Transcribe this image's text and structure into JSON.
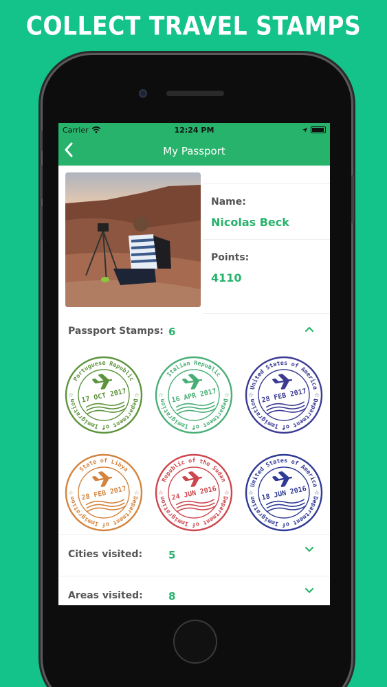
{
  "headline": "COLLECT TRAVEL STAMPS",
  "status_bar": {
    "carrier": "Carrier",
    "time": "12:24 PM"
  },
  "nav": {
    "title": "My Passport",
    "back_icon": "chevron-left-icon"
  },
  "profile": {
    "name_label": "Name:",
    "name_value": "Nicolas Beck",
    "points_label": "Points:",
    "points_value": "4110"
  },
  "stamps_section": {
    "label": "Passport Stamps:",
    "count": "6",
    "stamps": [
      {
        "country": "Portuguese Republic",
        "date": "17 OCT 2017",
        "dept": "Department of Immigration",
        "color": "#4f8a2c"
      },
      {
        "country": "Italian Republic",
        "date": "16 APR 2017",
        "dept": "Department of Immigration",
        "color": "#3aa86a"
      },
      {
        "country": "United States of America",
        "date": "28 FEB 2017",
        "dept": "Department of Immigration",
        "color": "#2a2a8a"
      },
      {
        "country": "State of Libya",
        "date": "28 FEB 2017",
        "dept": "Department of Immigration",
        "color": "#d07a2e"
      },
      {
        "country": "Republic of the Sudan",
        "date": "24 JUN 2016",
        "dept": "Department of Immigration",
        "color": "#c8383e"
      },
      {
        "country": "United States of America",
        "date": "18 JUN 2016",
        "dept": "Department of Immigration",
        "color": "#1e2a8c"
      }
    ]
  },
  "cities": {
    "label": "Cities visited:",
    "value": "5"
  },
  "areas": {
    "label": "Areas visited:",
    "value": "8"
  },
  "colors": {
    "accent": "#27b36b",
    "background": "#14c38a"
  }
}
